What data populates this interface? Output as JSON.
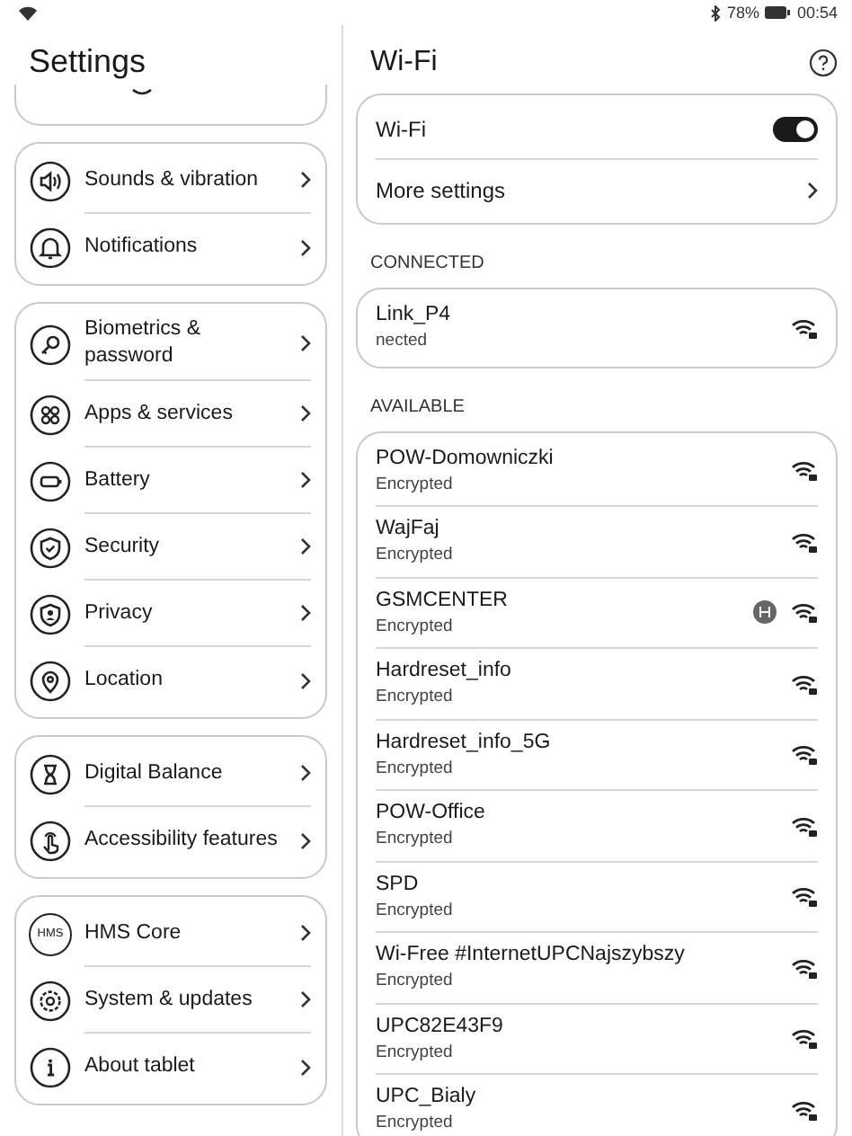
{
  "status_bar": {
    "battery": "78%",
    "time": "00:54"
  },
  "settings": {
    "title": "Settings",
    "groups": [
      {
        "items": [
          {
            "kind": "sound",
            "label": "Sounds & vibration"
          },
          {
            "kind": "bell",
            "label": "Notifications"
          }
        ]
      },
      {
        "items": [
          {
            "kind": "key",
            "label": "Biometrics & password"
          },
          {
            "kind": "apps",
            "label": "Apps & services"
          },
          {
            "kind": "battery",
            "label": "Battery"
          },
          {
            "kind": "shield",
            "label": "Security"
          },
          {
            "kind": "privacy",
            "label": "Privacy"
          },
          {
            "kind": "location",
            "label": "Location"
          }
        ]
      },
      {
        "items": [
          {
            "kind": "hourglass",
            "label": "Digital Balance"
          },
          {
            "kind": "hand",
            "label": "Accessibility features"
          }
        ]
      },
      {
        "items": [
          {
            "kind": "hms",
            "icon_text": "HMS",
            "label": "HMS Core"
          },
          {
            "kind": "gear",
            "label": "System & updates"
          },
          {
            "kind": "info",
            "label": "About tablet"
          }
        ]
      }
    ]
  },
  "wifi": {
    "title": "Wi-Fi",
    "toggle": {
      "label": "Wi-Fi",
      "on": true
    },
    "more": {
      "label": "More settings"
    },
    "connected_header": "CONNECTED",
    "connected": {
      "name": "Link_P4",
      "status": "nected"
    },
    "available_header": "AVAILABLE",
    "networks": [
      {
        "name": "POW-Domowniczki",
        "security": "Encrypted",
        "badge": false
      },
      {
        "name": "WajFaj",
        "security": "Encrypted",
        "badge": false
      },
      {
        "name": "GSMCENTER",
        "security": "Encrypted",
        "badge": true
      },
      {
        "name": "Hardreset_info",
        "security": "Encrypted",
        "badge": false
      },
      {
        "name": "Hardreset_info_5G",
        "security": "Encrypted",
        "badge": false
      },
      {
        "name": "POW-Office",
        "security": "Encrypted",
        "badge": false
      },
      {
        "name": "SPD",
        "security": "Encrypted",
        "badge": false
      },
      {
        "name": "Wi-Free #InternetUPCNajszybszy",
        "security": "Encrypted",
        "badge": false
      },
      {
        "name": "UPC82E43F9",
        "security": "Encrypted",
        "badge": false
      },
      {
        "name": "UPC_Bialy",
        "security": "Encrypted",
        "badge": false
      }
    ]
  }
}
